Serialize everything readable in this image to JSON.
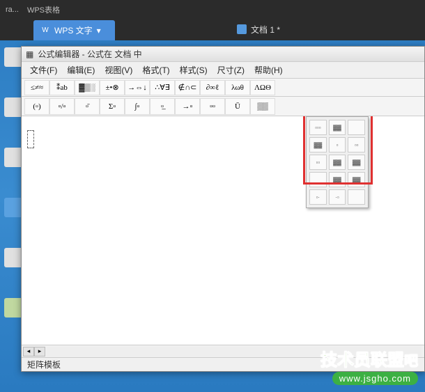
{
  "taskbar": {
    "items": [
      "ra...",
      "WPS表格"
    ]
  },
  "app_tab": {
    "label": "WPS 文字"
  },
  "doc_tab": {
    "label": "文档 1 *"
  },
  "editor": {
    "title": "公式编辑器 - 公式在 文档 中",
    "menus": [
      "文件(F)",
      "编辑(E)",
      "视图(V)",
      "格式(T)",
      "样式(S)",
      "尺寸(Z)",
      "帮助(H)"
    ],
    "toolbar1": [
      "≤≠≈",
      "⁑ab",
      "▓▒░",
      "±•⊗",
      "→⇔↓",
      "∴∀∃",
      "∉∩⊂",
      "∂∞ℓ",
      "λωθ",
      "ΛΩΘ"
    ],
    "toolbar2": [
      "(▫)",
      "▫/▫",
      "▫̄",
      "Σ▫",
      "∫▫",
      "▫̲",
      "→▫",
      "▫▫",
      "Ū",
      "▒▒"
    ],
    "matrix_popup": [
      "▫▫▫",
      "▓▓",
      "",
      "▓▓",
      "▫",
      "▫▫",
      "▫▫",
      "▓▓",
      "▓▓",
      "",
      "▓▓",
      "▓▓",
      "▫·",
      "·▫",
      ""
    ],
    "statusbar": "矩阵模板"
  },
  "watermark": {
    "text": "技术员联盟",
    "suffix": "吧",
    "url": "www.jsgho.com"
  }
}
